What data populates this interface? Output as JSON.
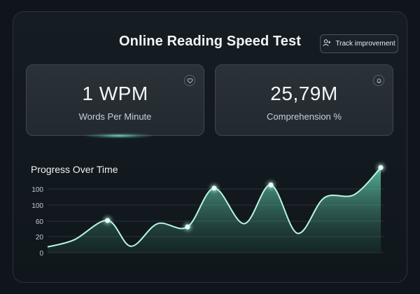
{
  "header": {
    "title": "Online Reading Speed Test",
    "track_button_label": "Track improvement"
  },
  "stats": [
    {
      "value": "1 WPM",
      "label": "Words Per Minute",
      "icon": "heart-icon"
    },
    {
      "value": "25,79M",
      "label": "Comprehension %",
      "icon": "bell-icon"
    }
  ],
  "colors": {
    "accent": "#8ff0d8",
    "background": "#0f151b",
    "card": "#262e34"
  },
  "chart_data": {
    "type": "area",
    "title": "Progress Over Time",
    "yticks": [
      0,
      20,
      60,
      100,
      100
    ],
    "x": [
      0,
      0.08,
      0.18,
      0.25,
      0.33,
      0.42,
      0.5,
      0.59,
      0.67,
      0.75,
      0.83,
      0.92,
      1.0
    ],
    "values": [
      9,
      20,
      50,
      10,
      45,
      40,
      100,
      45,
      105,
      30,
      85,
      90,
      132
    ],
    "highlighted_points": [
      2,
      5,
      6,
      8,
      12
    ],
    "ylim": [
      0,
      140
    ],
    "grid": true
  }
}
